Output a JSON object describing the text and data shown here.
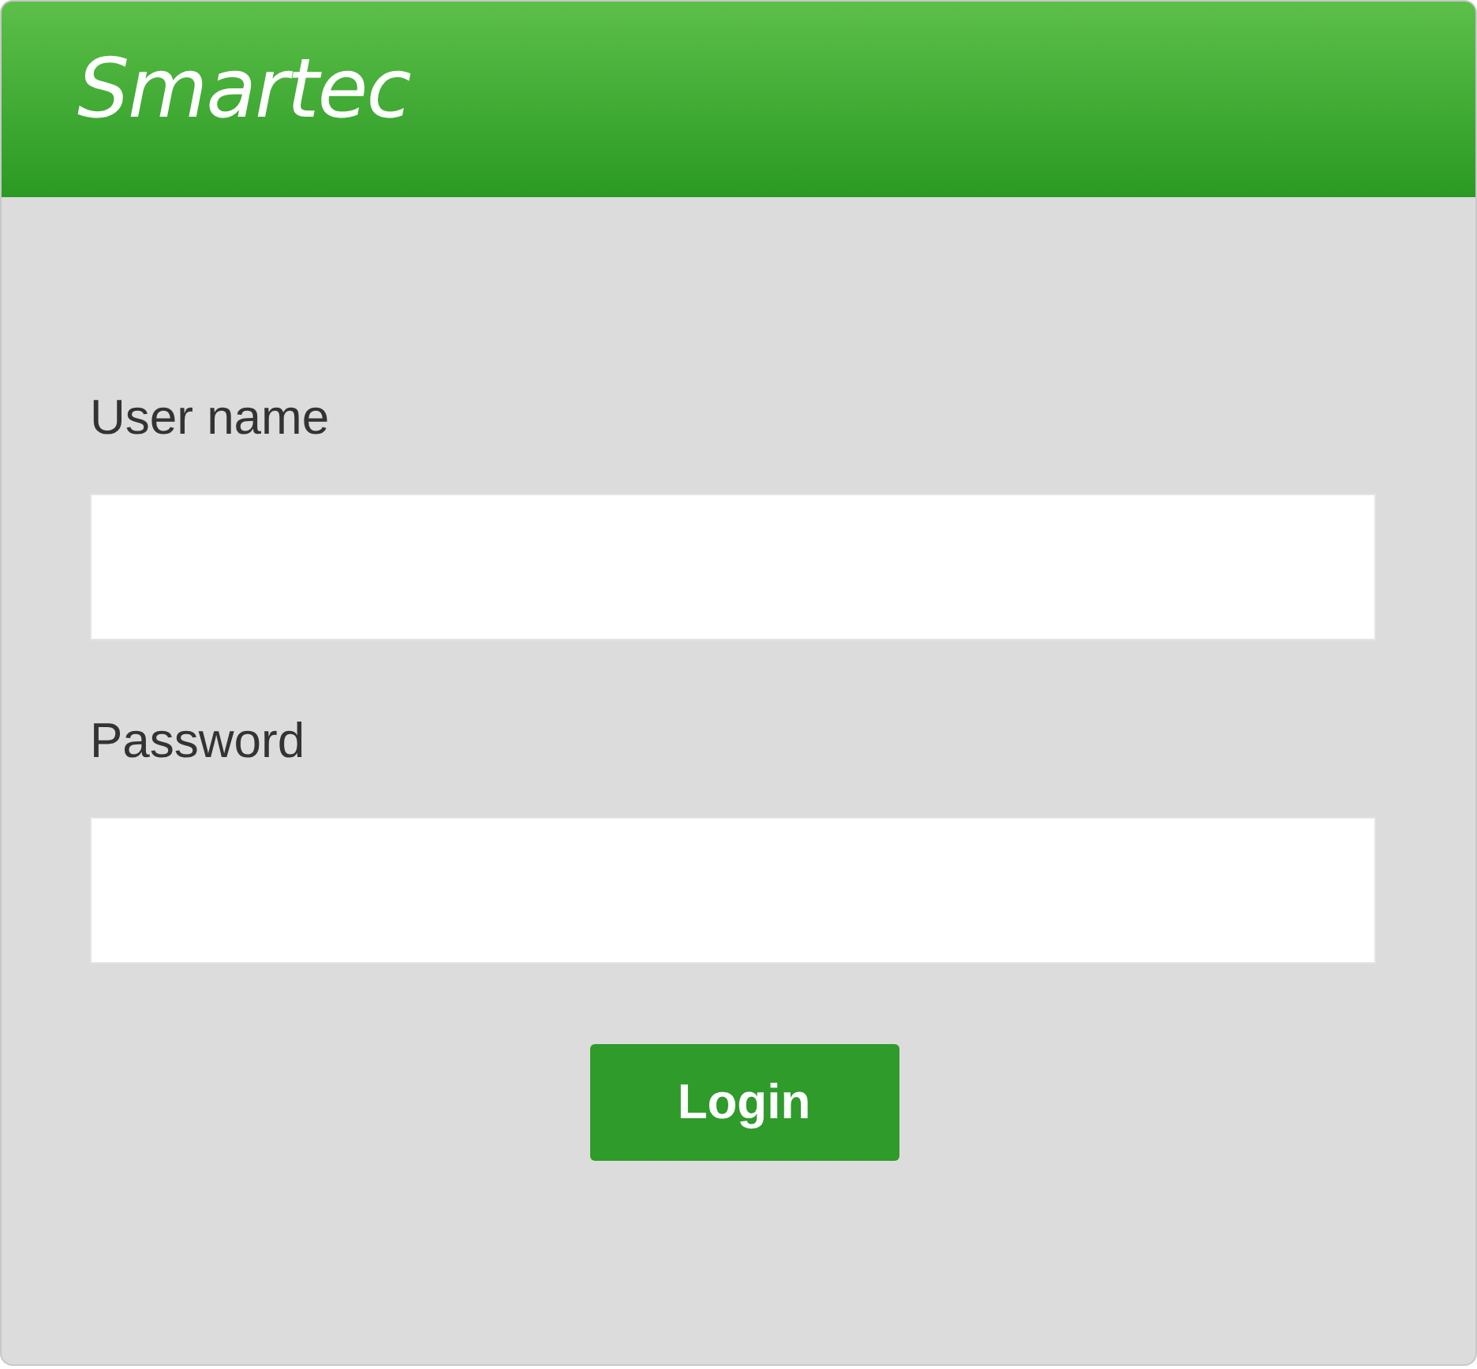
{
  "header": {
    "logo": "Smartec"
  },
  "form": {
    "fields": [
      {
        "label": "User name"
      },
      {
        "label": "Password"
      }
    ],
    "button": "Login"
  }
}
